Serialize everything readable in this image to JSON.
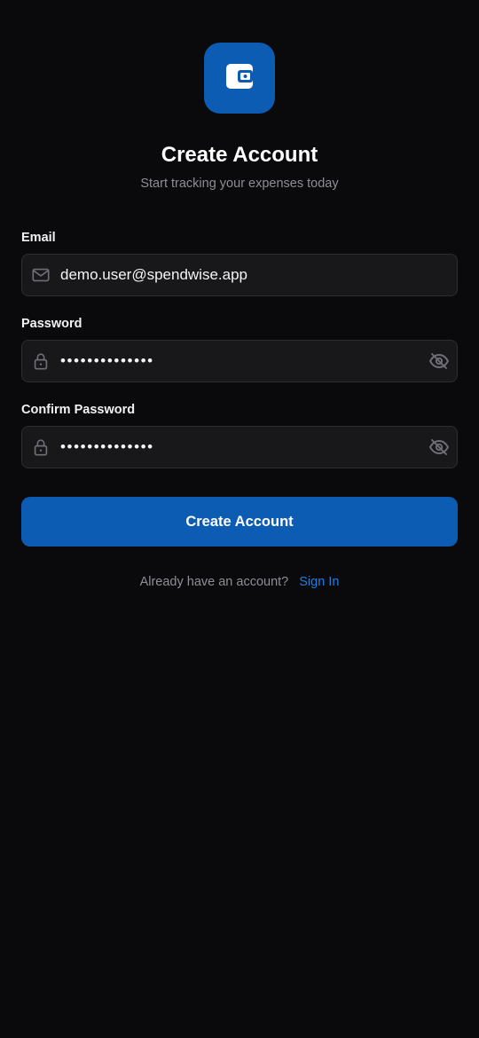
{
  "app": {
    "logo_icon": "wallet-icon",
    "brand_color": "#0d5cb4",
    "link_color": "#1f7fde"
  },
  "header": {
    "title": "Create Account",
    "subtitle": "Start tracking your expenses today"
  },
  "form": {
    "email": {
      "label": "Email",
      "value": "demo.user@spendwise.app",
      "icon": "mail-icon"
    },
    "password": {
      "label": "Password",
      "value": "••••••••••••••",
      "icon": "lock-icon",
      "toggle_icon": "eye-off-icon"
    },
    "confirm_password": {
      "label": "Confirm Password",
      "value": "••••••••••••••",
      "icon": "lock-icon",
      "toggle_icon": "eye-off-icon"
    },
    "submit_label": "Create Account"
  },
  "footer": {
    "prompt": "Already have an account?",
    "link_label": "Sign In"
  }
}
